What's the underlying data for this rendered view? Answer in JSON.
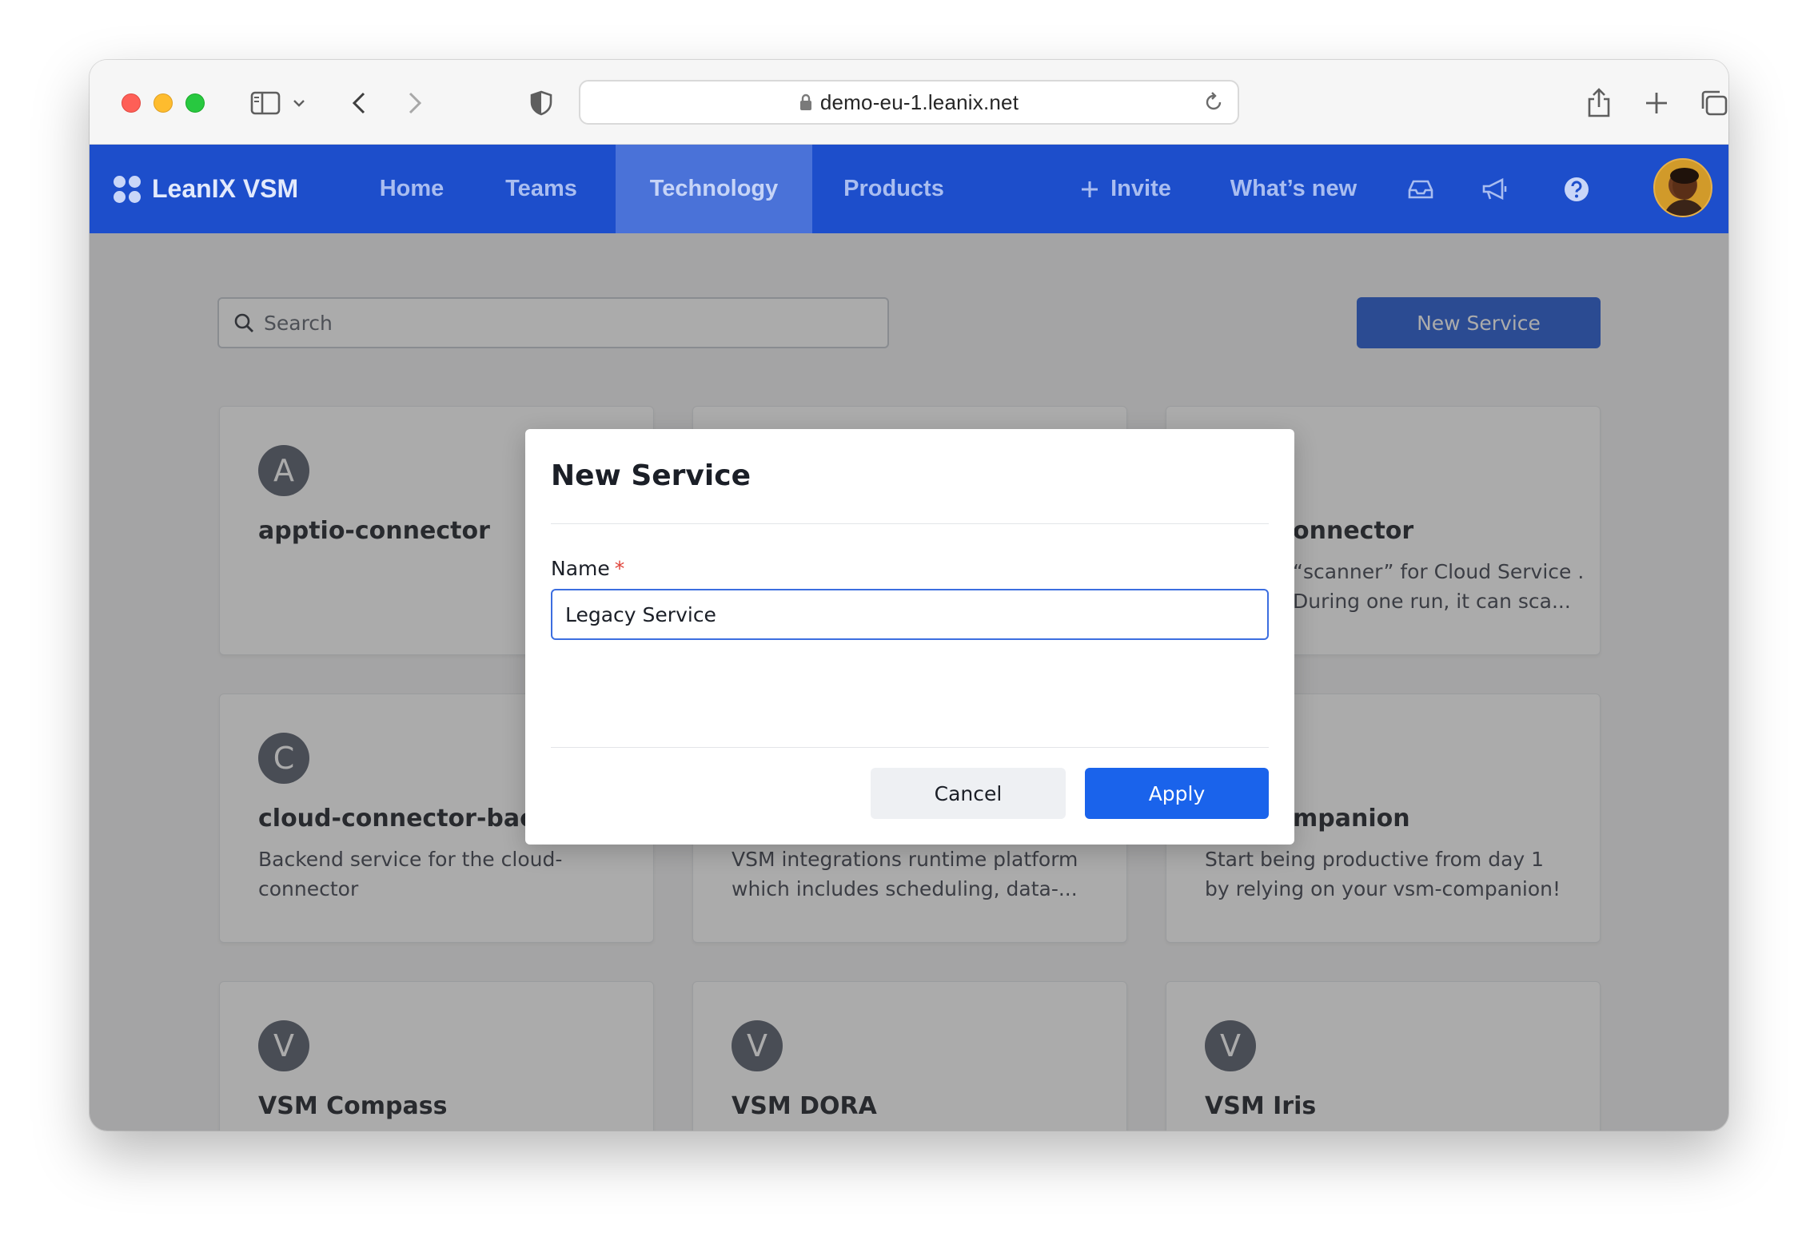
{
  "browser": {
    "url": "demo-eu-1.leanix.net"
  },
  "nav": {
    "brand": "LeanIX VSM",
    "items": [
      {
        "label": "Home",
        "active": false
      },
      {
        "label": "Teams",
        "active": false
      },
      {
        "label": "Technology",
        "active": true
      },
      {
        "label": "Products",
        "active": false
      }
    ],
    "invite": "Invite",
    "whats_new": "What’s new"
  },
  "toolbar": {
    "search_placeholder": "Search",
    "new_service_label": "New Service"
  },
  "cards": [
    {
      "initial": "A",
      "title": "apptio-connector",
      "description": ""
    },
    {
      "initial": "",
      "title": "",
      "description": ""
    },
    {
      "initial": "",
      "title": "onnector",
      "description": "“scanner” for Cloud Service . During one run, it can sca..."
    },
    {
      "initial": "C",
      "title": "cloud-connector-backe",
      "description": "Backend service for the cloud-connector"
    },
    {
      "initial": "",
      "title": "",
      "description": "VSM integrations runtime platform which includes scheduling, data-..."
    },
    {
      "initial": "",
      "title": "mpanion",
      "description": "Start being productive from day 1 by relying on your vsm-companion!"
    },
    {
      "initial": "V",
      "title": "VSM Compass",
      "description": ""
    },
    {
      "initial": "V",
      "title": "VSM DORA",
      "description": ""
    },
    {
      "initial": "V",
      "title": "VSM Iris",
      "description": ""
    }
  ],
  "modal": {
    "title": "New Service",
    "name_label": "Name",
    "required_mark": "*",
    "name_value": "Legacy Service",
    "cancel_label": "Cancel",
    "apply_label": "Apply"
  },
  "colors": {
    "nav_bg": "#1d4ecb",
    "primary": "#1a63eb",
    "required": "#e0443b"
  }
}
